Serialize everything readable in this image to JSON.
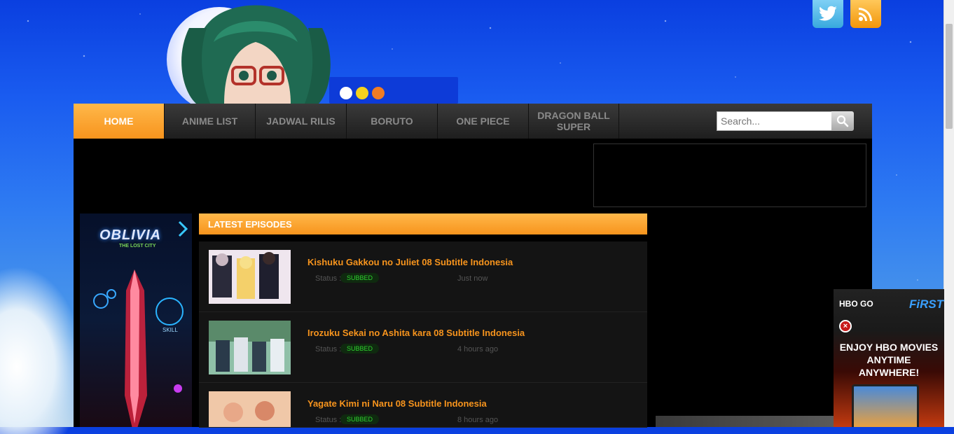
{
  "social": {
    "twitter_icon": "twitter-icon",
    "rss_icon": "rss-icon"
  },
  "nav": {
    "items": [
      {
        "label": "HOME",
        "active": true
      },
      {
        "label": "ANIME LIST"
      },
      {
        "label": "JADWAL RILIS"
      },
      {
        "label": "BORUTO"
      },
      {
        "label": "ONE PIECE"
      },
      {
        "label": "DRAGON BALL SUPER"
      }
    ],
    "search_placeholder": "Search...",
    "search_icon": "magnifier-icon"
  },
  "latest": {
    "heading": "LATEST EPISODES",
    "episodes": [
      {
        "title": "Kishuku Gakkou no Juliet 08 Subtitle Indonesia",
        "status_label": "Status :",
        "status": "SUBBED",
        "time": "Just now"
      },
      {
        "title": "Irozuku Sekai no Ashita kara 08 Subtitle Indonesia",
        "status_label": "Status :",
        "status": "SUBBED",
        "time": "4 hours ago"
      },
      {
        "title": "Yagate Kimi ni Naru 08 Subtitle Indonesia",
        "status_label": "Status :",
        "status": "SUBBED",
        "time": "8 hours ago"
      }
    ]
  },
  "side_ad": {
    "logo": "OBLIVIA",
    "tagline": "THE LOST CITY",
    "skill": "SKILL"
  },
  "hbo_ad": {
    "brand_left": "HBO GO",
    "brand_right": "FiRST",
    "line1": "ENJOY HBO MOVIES",
    "line2": "ANYTIME",
    "line3": "ANYWHERE!",
    "close": "×"
  },
  "colors": {
    "accent": "#f7941d",
    "nav_bg": "#2a2a2a",
    "badge_text": "#2fd32f",
    "sky": "#1a5cf0"
  }
}
